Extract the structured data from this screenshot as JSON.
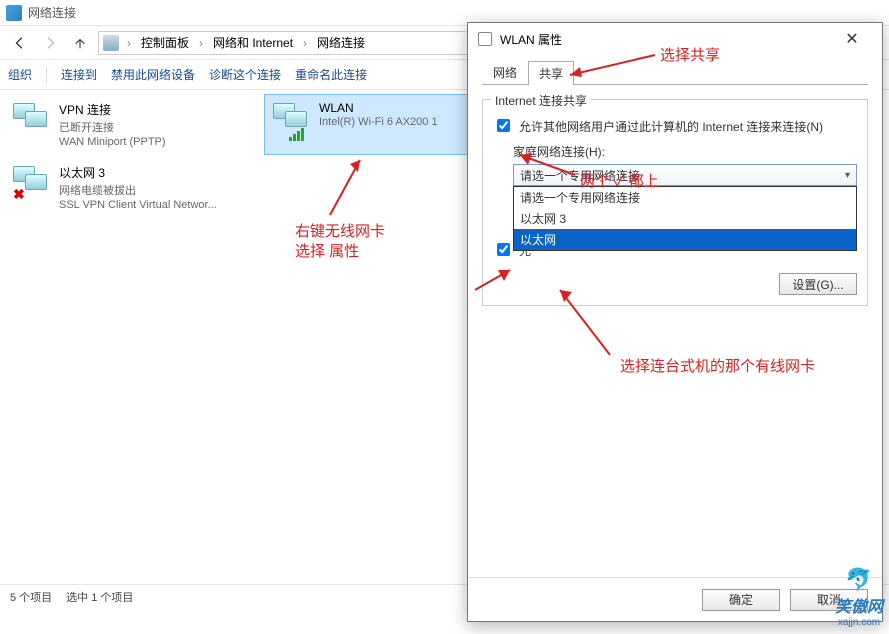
{
  "window": {
    "title": "网络连接"
  },
  "breadcrumb": {
    "a": "控制面板",
    "b": "网络和 Internet",
    "c": "网络连接"
  },
  "commands": {
    "org": "组织",
    "connect": "连接到",
    "disable": "禁用此网络设备",
    "diag": "诊断这个连接",
    "rename": "重命名此连接"
  },
  "connections": [
    {
      "name": "VPN 连接",
      "status": "已断开连接",
      "device": "WAN Miniport (PPTP)",
      "signal": false,
      "x": false
    },
    {
      "name": "WLAN",
      "status": "",
      "device": "Intel(R) Wi-Fi 6 AX200 1",
      "signal": true,
      "x": false,
      "selected": true
    },
    {
      "name": "以太网 3",
      "status": "网络电缆被拔出",
      "device": "SSL VPN Client Virtual Networ...",
      "signal": false,
      "x": true
    }
  ],
  "status": {
    "count": "5 个项目",
    "selected_label": "选中 1 个项目"
  },
  "dialog": {
    "title": "WLAN 属性",
    "tabs": {
      "network": "网络",
      "sharing": "共享"
    },
    "group_legend": "Internet 连接共享",
    "chk1": "允许其他网络用户通过此计算机的 Internet 连接来连接(N)",
    "home_label": "家庭网络连接(H):",
    "select_current": "请选一个专用网络连接",
    "options": [
      "请选一个专用网络连接",
      "以太网 3",
      "以太网"
    ],
    "chk2_prefix": "允",
    "settings_btn": "设置(G)...",
    "ok": "确定",
    "cancel": "取消"
  },
  "annotations": {
    "select_share": "选择共享",
    "rclick1": "右键无线网卡",
    "rclick2": "选择 属性",
    "both_check": "两个 ✓ 都上",
    "select_wired": "选择连台式机的那个有线网卡"
  },
  "watermark": {
    "name": "笑傲网",
    "url": "xajjn.com"
  }
}
